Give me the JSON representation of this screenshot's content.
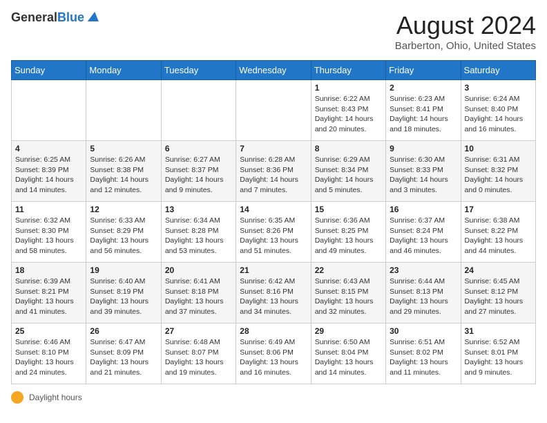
{
  "header": {
    "logo_general": "General",
    "logo_blue": "Blue",
    "month_year": "August 2024",
    "location": "Barberton, Ohio, United States"
  },
  "days_of_week": [
    "Sunday",
    "Monday",
    "Tuesday",
    "Wednesday",
    "Thursday",
    "Friday",
    "Saturday"
  ],
  "footer": {
    "daylight_label": "Daylight hours"
  },
  "weeks": [
    [
      {
        "day": "",
        "info": ""
      },
      {
        "day": "",
        "info": ""
      },
      {
        "day": "",
        "info": ""
      },
      {
        "day": "",
        "info": ""
      },
      {
        "day": "1",
        "info": "Sunrise: 6:22 AM\nSunset: 8:43 PM\nDaylight: 14 hours\nand 20 minutes."
      },
      {
        "day": "2",
        "info": "Sunrise: 6:23 AM\nSunset: 8:41 PM\nDaylight: 14 hours\nand 18 minutes."
      },
      {
        "day": "3",
        "info": "Sunrise: 6:24 AM\nSunset: 8:40 PM\nDaylight: 14 hours\nand 16 minutes."
      }
    ],
    [
      {
        "day": "4",
        "info": "Sunrise: 6:25 AM\nSunset: 8:39 PM\nDaylight: 14 hours\nand 14 minutes."
      },
      {
        "day": "5",
        "info": "Sunrise: 6:26 AM\nSunset: 8:38 PM\nDaylight: 14 hours\nand 12 minutes."
      },
      {
        "day": "6",
        "info": "Sunrise: 6:27 AM\nSunset: 8:37 PM\nDaylight: 14 hours\nand 9 minutes."
      },
      {
        "day": "7",
        "info": "Sunrise: 6:28 AM\nSunset: 8:36 PM\nDaylight: 14 hours\nand 7 minutes."
      },
      {
        "day": "8",
        "info": "Sunrise: 6:29 AM\nSunset: 8:34 PM\nDaylight: 14 hours\nand 5 minutes."
      },
      {
        "day": "9",
        "info": "Sunrise: 6:30 AM\nSunset: 8:33 PM\nDaylight: 14 hours\nand 3 minutes."
      },
      {
        "day": "10",
        "info": "Sunrise: 6:31 AM\nSunset: 8:32 PM\nDaylight: 14 hours\nand 0 minutes."
      }
    ],
    [
      {
        "day": "11",
        "info": "Sunrise: 6:32 AM\nSunset: 8:30 PM\nDaylight: 13 hours\nand 58 minutes."
      },
      {
        "day": "12",
        "info": "Sunrise: 6:33 AM\nSunset: 8:29 PM\nDaylight: 13 hours\nand 56 minutes."
      },
      {
        "day": "13",
        "info": "Sunrise: 6:34 AM\nSunset: 8:28 PM\nDaylight: 13 hours\nand 53 minutes."
      },
      {
        "day": "14",
        "info": "Sunrise: 6:35 AM\nSunset: 8:26 PM\nDaylight: 13 hours\nand 51 minutes."
      },
      {
        "day": "15",
        "info": "Sunrise: 6:36 AM\nSunset: 8:25 PM\nDaylight: 13 hours\nand 49 minutes."
      },
      {
        "day": "16",
        "info": "Sunrise: 6:37 AM\nSunset: 8:24 PM\nDaylight: 13 hours\nand 46 minutes."
      },
      {
        "day": "17",
        "info": "Sunrise: 6:38 AM\nSunset: 8:22 PM\nDaylight: 13 hours\nand 44 minutes."
      }
    ],
    [
      {
        "day": "18",
        "info": "Sunrise: 6:39 AM\nSunset: 8:21 PM\nDaylight: 13 hours\nand 41 minutes."
      },
      {
        "day": "19",
        "info": "Sunrise: 6:40 AM\nSunset: 8:19 PM\nDaylight: 13 hours\nand 39 minutes."
      },
      {
        "day": "20",
        "info": "Sunrise: 6:41 AM\nSunset: 8:18 PM\nDaylight: 13 hours\nand 37 minutes."
      },
      {
        "day": "21",
        "info": "Sunrise: 6:42 AM\nSunset: 8:16 PM\nDaylight: 13 hours\nand 34 minutes."
      },
      {
        "day": "22",
        "info": "Sunrise: 6:43 AM\nSunset: 8:15 PM\nDaylight: 13 hours\nand 32 minutes."
      },
      {
        "day": "23",
        "info": "Sunrise: 6:44 AM\nSunset: 8:13 PM\nDaylight: 13 hours\nand 29 minutes."
      },
      {
        "day": "24",
        "info": "Sunrise: 6:45 AM\nSunset: 8:12 PM\nDaylight: 13 hours\nand 27 minutes."
      }
    ],
    [
      {
        "day": "25",
        "info": "Sunrise: 6:46 AM\nSunset: 8:10 PM\nDaylight: 13 hours\nand 24 minutes."
      },
      {
        "day": "26",
        "info": "Sunrise: 6:47 AM\nSunset: 8:09 PM\nDaylight: 13 hours\nand 21 minutes."
      },
      {
        "day": "27",
        "info": "Sunrise: 6:48 AM\nSunset: 8:07 PM\nDaylight: 13 hours\nand 19 minutes."
      },
      {
        "day": "28",
        "info": "Sunrise: 6:49 AM\nSunset: 8:06 PM\nDaylight: 13 hours\nand 16 minutes."
      },
      {
        "day": "29",
        "info": "Sunrise: 6:50 AM\nSunset: 8:04 PM\nDaylight: 13 hours\nand 14 minutes."
      },
      {
        "day": "30",
        "info": "Sunrise: 6:51 AM\nSunset: 8:02 PM\nDaylight: 13 hours\nand 11 minutes."
      },
      {
        "day": "31",
        "info": "Sunrise: 6:52 AM\nSunset: 8:01 PM\nDaylight: 13 hours\nand 9 minutes."
      }
    ]
  ]
}
